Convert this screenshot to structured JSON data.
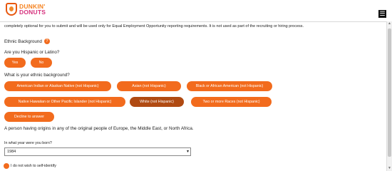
{
  "header": {
    "logo_line1": "DUNKIN'",
    "logo_line2": "DONUTS",
    "menu_icon": "menu-icon"
  },
  "intro_text": "completely optional for you to submit and will be used only for Equal Employment Opportunity reporting requirements. It is not used as part of the recruiting or hiring process.",
  "ethnic_background": {
    "title": "Ethnic Background",
    "help_icon_text": "?",
    "hispanic_question": "Are you Hispanic or Latino?",
    "hispanic_options": [
      "Yes",
      "No"
    ],
    "ethnic_question": "What is your ethnic background?",
    "ethnic_options": [
      "American Indian or Alaskan Native (not Hispanic)",
      "Asian (not Hispanic)",
      "Black or African American (not Hispanic)",
      "Native Hawaiian or Other Pacific Islander (not Hispanic)",
      "White (not Hispanic)",
      "Two or more Races (not Hispanic)",
      "Decline to answer"
    ],
    "selected_option": "White (not Hispanic)",
    "selection_note": "A person having origins in any of the original people of Europe, the Middle East, or North Africa."
  },
  "birth_year": {
    "label": "In what year were you born?",
    "value": "1984"
  },
  "opt_out_label": "I do not wish to self-identify",
  "colors": {
    "accent": "#f26b1d",
    "selected": "#b04a12"
  }
}
